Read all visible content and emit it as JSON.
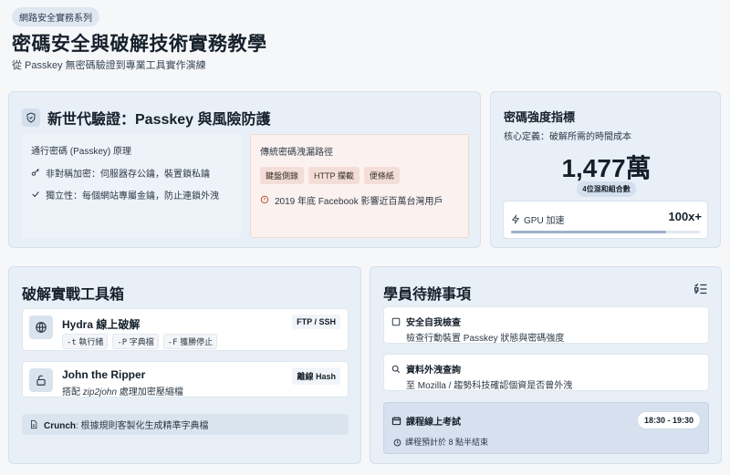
{
  "header": {
    "tag": "網路安全實務系列",
    "title": "密碼安全與破解技術實務教學",
    "subtitle": "從 Passkey 無密碼驗證到專業工具實作演練"
  },
  "passkey": {
    "title": "新世代驗證：Passkey 與風險防護",
    "left": {
      "heading": "通行密碼 (Passkey) 原理",
      "lines": [
        "非對稱加密：伺服器存公鑰，裝置鎖私鑰",
        "獨立性：每個網站專屬金鑰，防止連鎖外洩"
      ]
    },
    "right": {
      "heading": "傳統密碼洩漏路徑",
      "chips": [
        "鍵盤側錄",
        "HTTP 攔截",
        "便條紙"
      ],
      "note": "2019 年底 Facebook 影響近百萬台灣用戶"
    }
  },
  "strength": {
    "title": "密碼強度指標",
    "definition": "核心定義：破解所需的時間成本",
    "big_value": "1,477萬",
    "pill": "4位混和組合數",
    "gpu_label": "GPU 加速",
    "gpu_value": "100x+",
    "gpu_fill": 0.82
  },
  "tools": {
    "title": "破解實戰工具箱",
    "hydra": {
      "name": "Hydra 線上破解",
      "badge": "FTP / SSH",
      "flags": [
        {
          "flag": "-t",
          "desc": "執行緒"
        },
        {
          "flag": "-P",
          "desc": "字典檔"
        },
        {
          "flag": "-F",
          "desc": "獲勝停止"
        }
      ]
    },
    "john": {
      "name": "John the Ripper",
      "badge": "離線 Hash",
      "desc_prefix": "搭配 ",
      "desc_em": "zip2john",
      "desc_suffix": " 處理加密壓縮檔"
    },
    "crunch": {
      "name": "Crunch",
      "desc": ": 根據規則客製化生成精準字典檔"
    }
  },
  "todo": {
    "title": "學員待辦事項",
    "items": [
      {
        "title": "安全自我檢查",
        "desc": "檢查行動裝置 Passkey 狀態與密碼強度"
      },
      {
        "title": "資料外洩查詢",
        "desc": "至 Mozilla / 趨勢科技確認個資是否曾外洩"
      }
    ],
    "exam": {
      "title": "課程線上考試",
      "time": "18:30 - 19:30",
      "note": "課程預計於 8 點半結束"
    }
  },
  "colors": {
    "card_bg": "#e8eff7",
    "warn_bg": "#fbf1ee",
    "accent": "#9db2cc"
  }
}
